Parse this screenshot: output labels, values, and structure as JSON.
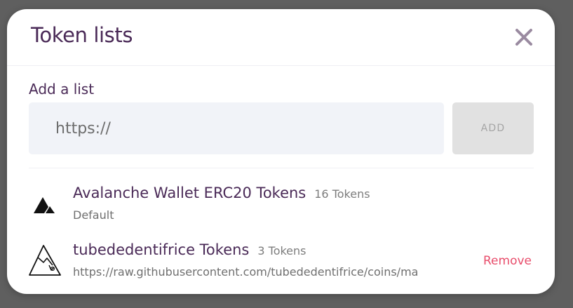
{
  "modal": {
    "title": "Token lists",
    "close_icon": "close-icon"
  },
  "add_list": {
    "label": "Add a list",
    "input_value": "https://",
    "button_label": "ADD"
  },
  "lists": [
    {
      "icon": "avalanche-logo-icon",
      "name": "Avalanche Wallet ERC20 Tokens",
      "count": "16 Tokens",
      "subtitle": "Default"
    },
    {
      "icon": "mountain-outline-icon",
      "name": "tubededentifrice Tokens",
      "count": "3 Tokens",
      "subtitle": "https://raw.githubusercontent.com/tubededentifrice/coins/ma",
      "action": "Remove"
    }
  ],
  "colors": {
    "title": "#4a2a57",
    "remove": "#e84d6b",
    "input_bg": "#f1f3f8",
    "button_bg": "#e1e1e1",
    "overlay": "#5f5f5f"
  }
}
